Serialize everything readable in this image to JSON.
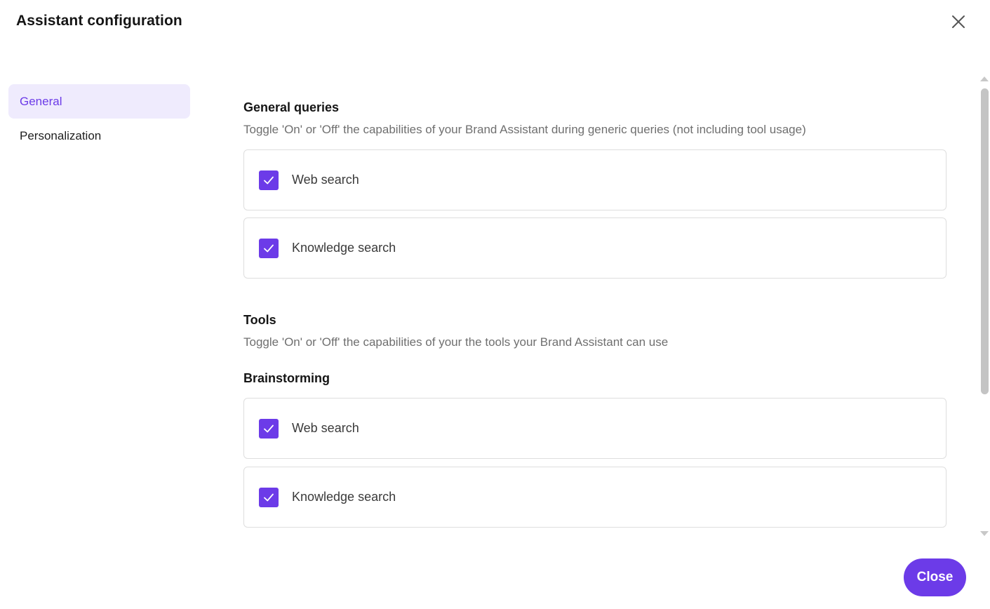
{
  "dialog": {
    "title": "Assistant configuration",
    "close_icon": "close-icon",
    "close_button_label": "Close"
  },
  "sidebar": {
    "items": [
      {
        "label": "General",
        "active": true
      },
      {
        "label": "Personalization",
        "active": false
      }
    ]
  },
  "general_queries": {
    "title": "General queries",
    "description": "Toggle 'On' or 'Off' the capabilities of your Brand Assistant during generic queries (not including tool usage)",
    "options": [
      {
        "label": "Web search",
        "checked": true
      },
      {
        "label": "Knowledge search",
        "checked": true
      }
    ]
  },
  "tools": {
    "title": "Tools",
    "description": "Toggle 'On' or 'Off' the capabilities of your the tools your Brand Assistant can use",
    "brainstorming": {
      "title": "Brainstorming",
      "options": [
        {
          "label": "Web search",
          "checked": true
        },
        {
          "label": "Knowledge search",
          "checked": true
        }
      ]
    }
  },
  "colors": {
    "accent": "#6c3be8",
    "active_nav_bg": "#efebfd",
    "card_border": "#dedede",
    "muted_text": "#6f6f6f"
  }
}
